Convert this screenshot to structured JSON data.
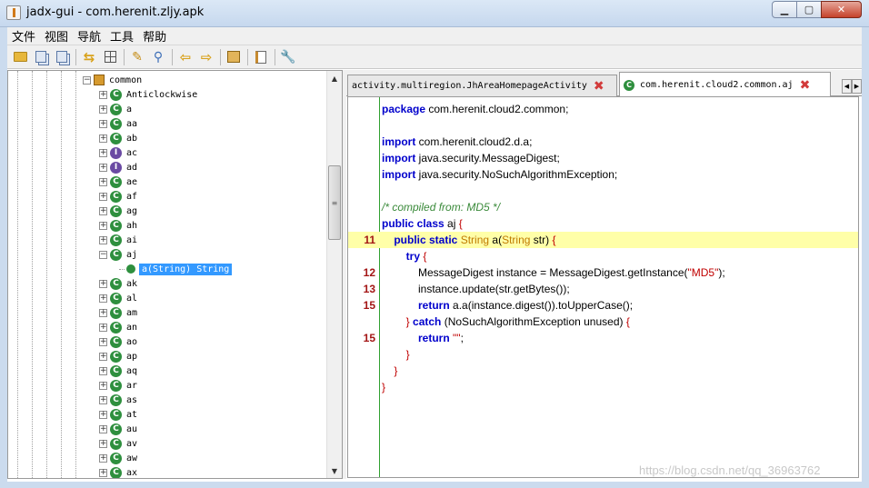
{
  "window": {
    "title": "jadx-gui - com.herenit.zljy.apk"
  },
  "menu": [
    "文件",
    "视图",
    "导航",
    "工具",
    "帮助"
  ],
  "toolbar": [
    {
      "name": "open-file-icon"
    },
    {
      "name": "save-all-icon"
    },
    {
      "name": "export-icon"
    },
    {
      "name": "sync-tree-icon"
    },
    {
      "name": "flatten-packages-icon"
    },
    {
      "name": "text-search-icon"
    },
    {
      "name": "class-search-icon"
    },
    {
      "name": "back-icon"
    },
    {
      "name": "forward-icon"
    },
    {
      "name": "deobfuscation-icon"
    },
    {
      "name": "log-viewer-icon"
    },
    {
      "name": "preferences-icon"
    }
  ],
  "tree": {
    "package": "common",
    "items": [
      {
        "label": "Anticlockwise",
        "kind": "class"
      },
      {
        "label": "a",
        "kind": "class"
      },
      {
        "label": "aa",
        "kind": "class"
      },
      {
        "label": "ab",
        "kind": "class"
      },
      {
        "label": "ac",
        "kind": "interface"
      },
      {
        "label": "ad",
        "kind": "interface"
      },
      {
        "label": "ae",
        "kind": "class"
      },
      {
        "label": "af",
        "kind": "class"
      },
      {
        "label": "ag",
        "kind": "class"
      },
      {
        "label": "ah",
        "kind": "class"
      },
      {
        "label": "ai",
        "kind": "class"
      },
      {
        "label": "aj",
        "kind": "class",
        "expanded": true
      },
      {
        "label": "a(String)  String",
        "kind": "method",
        "selected": true
      },
      {
        "label": "ak",
        "kind": "class"
      },
      {
        "label": "al",
        "kind": "class"
      },
      {
        "label": "am",
        "kind": "class"
      },
      {
        "label": "an",
        "kind": "class"
      },
      {
        "label": "ao",
        "kind": "class"
      },
      {
        "label": "ap",
        "kind": "class"
      },
      {
        "label": "aq",
        "kind": "class"
      },
      {
        "label": "ar",
        "kind": "class"
      },
      {
        "label": "as",
        "kind": "class"
      },
      {
        "label": "at",
        "kind": "class"
      },
      {
        "label": "au",
        "kind": "class"
      },
      {
        "label": "av",
        "kind": "class"
      },
      {
        "label": "aw",
        "kind": "class"
      },
      {
        "label": "ax",
        "kind": "class"
      }
    ]
  },
  "tabs": [
    {
      "label": "activity.multiregion.JhAreaHomepageActivity",
      "active": false
    },
    {
      "label": "com.herenit.cloud2.common.aj",
      "active": true
    }
  ],
  "code": [
    {
      "ln": "",
      "html": "<span class=\"kw\">package</span> com.herenit.cloud2.common;"
    },
    {
      "ln": "",
      "html": ""
    },
    {
      "ln": "",
      "html": "<span class=\"kw\">import</span> com.herenit.cloud2.d.a;"
    },
    {
      "ln": "",
      "html": "<span class=\"kw\">import</span> java.security.MessageDigest;"
    },
    {
      "ln": "",
      "html": "<span class=\"kw\">import</span> java.security.NoSuchAlgorithmException;"
    },
    {
      "ln": "",
      "html": ""
    },
    {
      "ln": "",
      "html": "<span class=\"cmt\">/* compiled from: MD5 */</span>"
    },
    {
      "ln": "",
      "html": "<span class=\"kw\">public class</span> aj <span class=\"pun\">{</span>"
    },
    {
      "ln": "11",
      "hl": true,
      "html": "    <span class=\"kw\">public static</span> <span class=\"type\">String</span> a(<span class=\"type\">String</span> str) <span class=\"pun\">{</span>"
    },
    {
      "ln": "",
      "html": "        <span class=\"kw\">try</span> <span class=\"pun\">{</span>"
    },
    {
      "ln": "12",
      "html": "            MessageDigest instance = MessageDigest.getInstance(<span class=\"str\">\"MD5\"</span>);"
    },
    {
      "ln": "13",
      "html": "            instance.update(str.getBytes());"
    },
    {
      "ln": "15",
      "html": "            <span class=\"kw\">return</span> a.a(instance.digest()).toUpperCase();"
    },
    {
      "ln": "",
      "html": "        <span class=\"pun\">}</span> <span class=\"kw\">catch</span> (NoSuchAlgorithmException unused) <span class=\"pun\">{</span>"
    },
    {
      "ln": "15",
      "html": "            <span class=\"kw\">return</span> <span class=\"str\">\"\"</span>;"
    },
    {
      "ln": "",
      "html": "        <span class=\"pun\">}</span>"
    },
    {
      "ln": "",
      "html": "    <span class=\"pun\">}</span>"
    },
    {
      "ln": "",
      "html": "<span class=\"pun\">}</span>"
    }
  ],
  "watermark": "https://blog.csdn.net/qq_36963762"
}
